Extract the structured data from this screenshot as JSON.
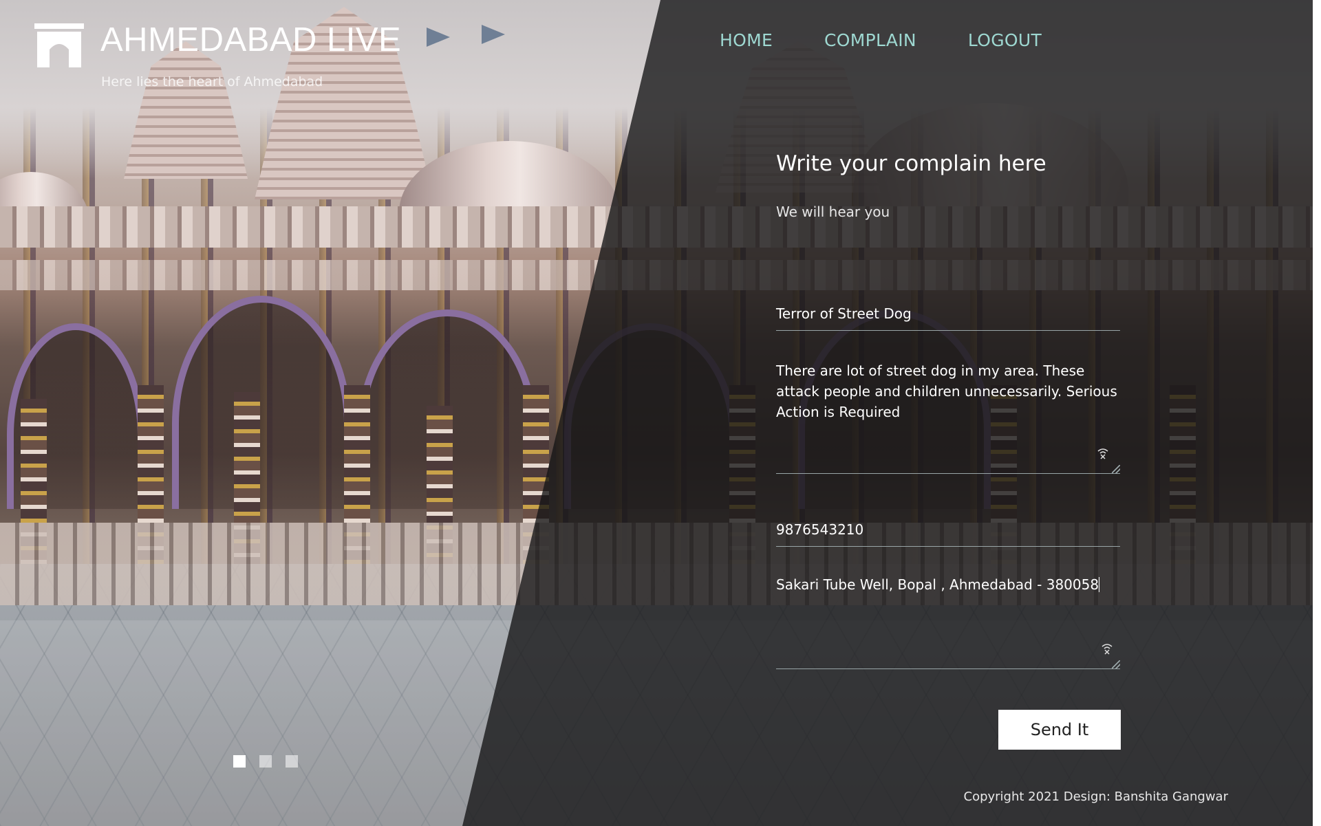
{
  "brand": {
    "title": "AHMEDABAD LIVE",
    "tagline": "Here lies the heart of Ahmedabad"
  },
  "nav": {
    "items": [
      {
        "label": "HOME"
      },
      {
        "label": "COMPLAIN"
      },
      {
        "label": "LOGOUT"
      }
    ]
  },
  "form": {
    "title": "Write your complain here",
    "subtitle": "We will hear you",
    "subject_value": "Terror of Street Dog",
    "description_value": "There are lot of street dog in my area. These attack people and children unnecessarily. Serious Action is Required",
    "phone_value": "9876543210",
    "address_value": "Sakari Tube Well, Bopal , Ahmedabad - 380058",
    "submit_label": "Send It"
  },
  "slider": {
    "count": 3,
    "active_index": 0
  },
  "footer": {
    "copyright": "Copyright 2021 Design: Banshita Gangwar"
  },
  "colors": {
    "nav_link": "#9ed8d1",
    "button_bg": "#ffffff",
    "overlay": "rgba(20,20,22,0.78)"
  },
  "icons": [
    "logo-gate-icon",
    "grammar-check-icon",
    "resize-grip-icon"
  ]
}
